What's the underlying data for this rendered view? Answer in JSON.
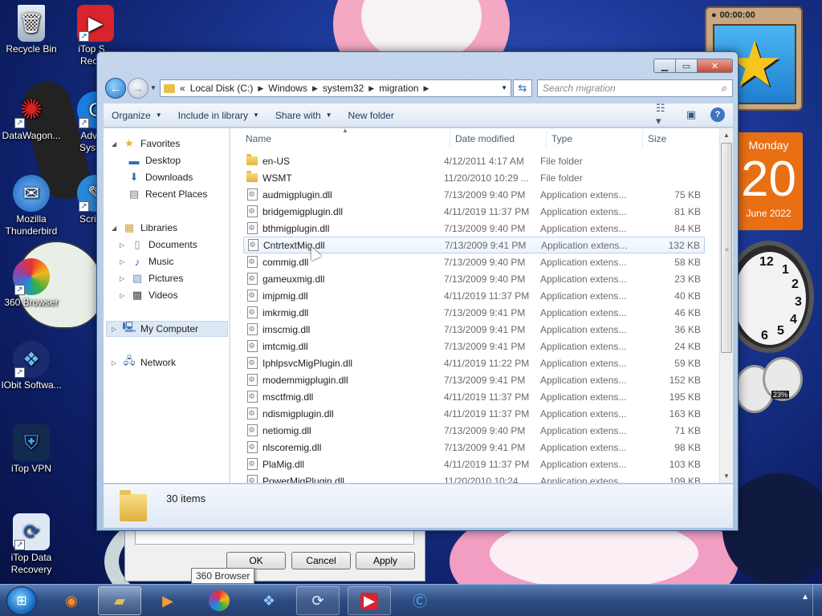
{
  "desktop": {
    "icons": [
      {
        "label": "Recycle Bin",
        "icon": "recycle-bin-icon"
      },
      {
        "label": "iTop S... Reco...",
        "icon": "itop-screen-recorder-icon"
      },
      {
        "label": "DataWagon...",
        "icon": "datawagon-icon"
      },
      {
        "label": "Adva... Syste...",
        "icon": "advanced-systemcare-icon"
      },
      {
        "label": "Mozilla Thunderbird",
        "icon": "thunderbird-icon"
      },
      {
        "label": "Scribus",
        "icon": "scribus-icon"
      },
      {
        "label": "360 Browser",
        "icon": "360-browser-icon"
      },
      {
        "label": "IObit Softwa...",
        "icon": "iobit-software-icon"
      },
      {
        "label": "iTop VPN",
        "icon": "itop-vpn-icon"
      },
      {
        "label": "iTop Data Recovery",
        "icon": "itop-data-recovery-icon"
      }
    ]
  },
  "gadgets": {
    "timer": "00:00:00",
    "calendar": {
      "day": "Monday",
      "date": "20",
      "month_year": "June 2022"
    },
    "clock_numbers": [
      "12",
      "1",
      "2",
      "3",
      "4",
      "5",
      "6"
    ],
    "meter_percent": "23%"
  },
  "background_dialog": {
    "ok": "OK",
    "cancel": "Cancel",
    "apply": "Apply",
    "tooltip": "360 Browser"
  },
  "explorer": {
    "address": {
      "prefix": "«",
      "crumbs": [
        "Local Disk (C:)",
        "Windows",
        "system32",
        "migration"
      ]
    },
    "search_placeholder": "Search migration",
    "toolbar": {
      "organize": "Organize",
      "include": "Include in library",
      "share": "Share with",
      "new_folder": "New folder"
    },
    "nav": {
      "favorites": "Favorites",
      "desktop": "Desktop",
      "downloads": "Downloads",
      "recent": "Recent Places",
      "libraries": "Libraries",
      "documents": "Documents",
      "music": "Music",
      "pictures": "Pictures",
      "videos": "Videos",
      "computer": "My Computer",
      "network": "Network"
    },
    "columns": {
      "name": "Name",
      "date": "Date modified",
      "type": "Type",
      "size": "Size"
    },
    "files": [
      {
        "name": "en-US",
        "date": "4/12/2011 4:17 AM",
        "type": "File folder",
        "size": "",
        "kind": "folder"
      },
      {
        "name": "WSMT",
        "date": "11/20/2010 10:29 ...",
        "type": "File folder",
        "size": "",
        "kind": "folder"
      },
      {
        "name": "audmigplugin.dll",
        "date": "7/13/2009 9:40 PM",
        "type": "Application extens...",
        "size": "75 KB",
        "kind": "dll"
      },
      {
        "name": "bridgemigplugin.dll",
        "date": "4/11/2019 11:37 PM",
        "type": "Application extens...",
        "size": "81 KB",
        "kind": "dll"
      },
      {
        "name": "bthmigplugin.dll",
        "date": "7/13/2009 9:40 PM",
        "type": "Application extens...",
        "size": "84 KB",
        "kind": "dll"
      },
      {
        "name": "CntrtextMig.dll",
        "date": "7/13/2009 9:41 PM",
        "type": "Application extens...",
        "size": "132 KB",
        "kind": "dll"
      },
      {
        "name": "commig.dll",
        "date": "7/13/2009 9:40 PM",
        "type": "Application extens...",
        "size": "58 KB",
        "kind": "dll"
      },
      {
        "name": "gameuxmig.dll",
        "date": "7/13/2009 9:40 PM",
        "type": "Application extens...",
        "size": "23 KB",
        "kind": "dll"
      },
      {
        "name": "imjpmig.dll",
        "date": "4/11/2019 11:37 PM",
        "type": "Application extens...",
        "size": "40 KB",
        "kind": "dll"
      },
      {
        "name": "imkrmig.dll",
        "date": "7/13/2009 9:41 PM",
        "type": "Application extens...",
        "size": "46 KB",
        "kind": "dll"
      },
      {
        "name": "imscmig.dll",
        "date": "7/13/2009 9:41 PM",
        "type": "Application extens...",
        "size": "36 KB",
        "kind": "dll"
      },
      {
        "name": "imtcmig.dll",
        "date": "7/13/2009 9:41 PM",
        "type": "Application extens...",
        "size": "24 KB",
        "kind": "dll"
      },
      {
        "name": "IphlpsvcMigPlugin.dll",
        "date": "4/11/2019 11:22 PM",
        "type": "Application extens...",
        "size": "59 KB",
        "kind": "dll"
      },
      {
        "name": "modemmigplugin.dll",
        "date": "7/13/2009 9:41 PM",
        "type": "Application extens...",
        "size": "152 KB",
        "kind": "dll"
      },
      {
        "name": "msctfmig.dll",
        "date": "4/11/2019 11:37 PM",
        "type": "Application extens...",
        "size": "195 KB",
        "kind": "dll"
      },
      {
        "name": "ndismigplugin.dll",
        "date": "4/11/2019 11:37 PM",
        "type": "Application extens...",
        "size": "163 KB",
        "kind": "dll"
      },
      {
        "name": "netiomig.dll",
        "date": "7/13/2009 9:40 PM",
        "type": "Application extens...",
        "size": "71 KB",
        "kind": "dll"
      },
      {
        "name": "nlscoremig.dll",
        "date": "7/13/2009 9:41 PM",
        "type": "Application extens...",
        "size": "98 KB",
        "kind": "dll"
      },
      {
        "name": "PlaMig.dll",
        "date": "4/11/2019 11:37 PM",
        "type": "Application extens...",
        "size": "103 KB",
        "kind": "dll"
      },
      {
        "name": "PowerMigPlugin.dll",
        "date": "11/20/2010 10:24 ...",
        "type": "Application extens...",
        "size": "109 KB",
        "kind": "dll"
      }
    ],
    "hovered_index": 5,
    "status": "30 items"
  },
  "taskbar": {
    "apps": [
      {
        "icon": "firefox-icon",
        "state": "pinned"
      },
      {
        "icon": "file-explorer-icon",
        "state": "active"
      },
      {
        "icon": "media-player-icon",
        "state": "pinned"
      },
      {
        "icon": "360-browser-icon",
        "state": "pinned"
      },
      {
        "icon": "iobit-icon",
        "state": "pinned"
      },
      {
        "icon": "itop-data-recovery-icon",
        "state": "open"
      },
      {
        "icon": "itop-screen-recorder-icon",
        "state": "open"
      },
      {
        "icon": "ccleaner-icon",
        "state": "pinned"
      }
    ]
  }
}
